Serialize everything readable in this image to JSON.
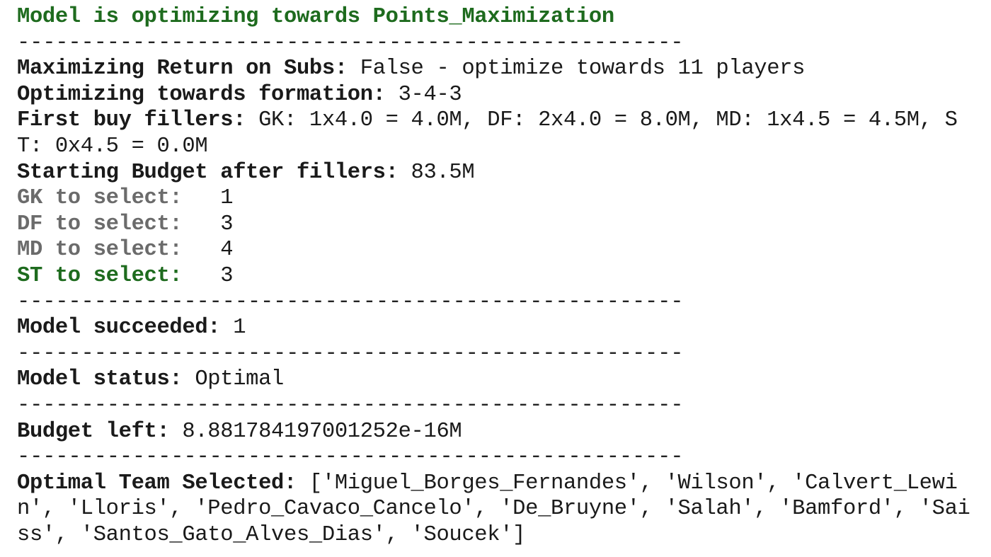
{
  "header": {
    "title": "Model is optimizing towards Points_Maximization"
  },
  "separator": "----------------------------------------------------",
  "settings": {
    "subs_label": "Maximizing Return on Subs:",
    "subs_value": " False - optimize towards 11 players",
    "formation_label": "Optimizing towards formation:",
    "formation_value": " 3-4-3",
    "fillers_label": "First buy fillers:",
    "fillers_value": " GK: 1x4.0 = 4.0M, DF: 2x4.0 = 8.0M, MD: 1x4.5 = 4.5M, ST: 0x4.5 = 0.0M",
    "budget_label": "Starting Budget after fillers:",
    "budget_value": " 83.5M"
  },
  "positions": [
    {
      "label": "GK to select:  ",
      "value": " 1"
    },
    {
      "label": "DF to select:  ",
      "value": " 3"
    },
    {
      "label": "MD to select:  ",
      "value": " 4"
    },
    {
      "label": "ST to select:  ",
      "value": " 3"
    }
  ],
  "results": {
    "succeeded_label": "Model succeeded:",
    "succeeded_value": " 1",
    "status_label": "Model status:",
    "status_value": " Optimal",
    "budget_left_label": "Budget left:",
    "budget_left_value": " 8.881784197001252e-16M",
    "team_label": "Optimal Team Selected:",
    "team_value": " ['Miguel_Borges_Fernandes', 'Wilson', 'Calvert_Lewin', 'Lloris', 'Pedro_Cavaco_Cancelo', 'De_Bruyne', 'Salah', 'Bamford', 'Saiss', 'Santos_Gato_Alves_Dias', 'Soucek']"
  },
  "colors": {
    "green": "#1e6b1e",
    "grey": "#6b6b6b",
    "text": "#1a1a1a"
  }
}
